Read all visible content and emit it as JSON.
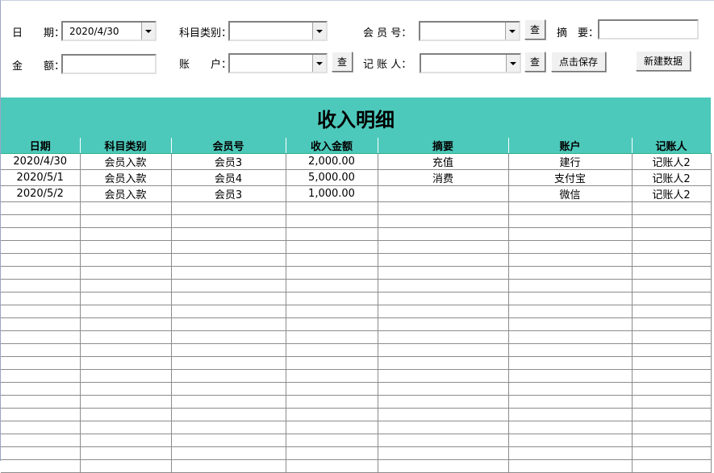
{
  "form": {
    "date_label": "日　　期：",
    "date_value": "2020/4/30",
    "category_label": "科目类别：",
    "member_label": "会 员 号：",
    "summary_label": "摘　要：",
    "amount_label": "金　　额：",
    "account_label": "账　　户：",
    "bookkeeper_label": "记 账 人：",
    "lookup_label": "查",
    "save_label": "点击保存",
    "new_label": "新建数据"
  },
  "sheet": {
    "title": "收入明细",
    "headers": [
      "日期",
      "科目类别",
      "会员号",
      "收入金额",
      "摘要",
      "账户",
      "记账人"
    ],
    "rows": [
      [
        "2020/4/30",
        "会员入款",
        "会员3",
        "2,000.00",
        "充值",
        "建行",
        "记账人2"
      ],
      [
        "2020/5/1",
        "会员入款",
        "会员4",
        "5,000.00",
        "消费",
        "支付宝",
        "记账人2"
      ],
      [
        "2020/5/2",
        "会员入款",
        "会员3",
        "1,000.00",
        "",
        "微信",
        "记账人2"
      ]
    ]
  }
}
